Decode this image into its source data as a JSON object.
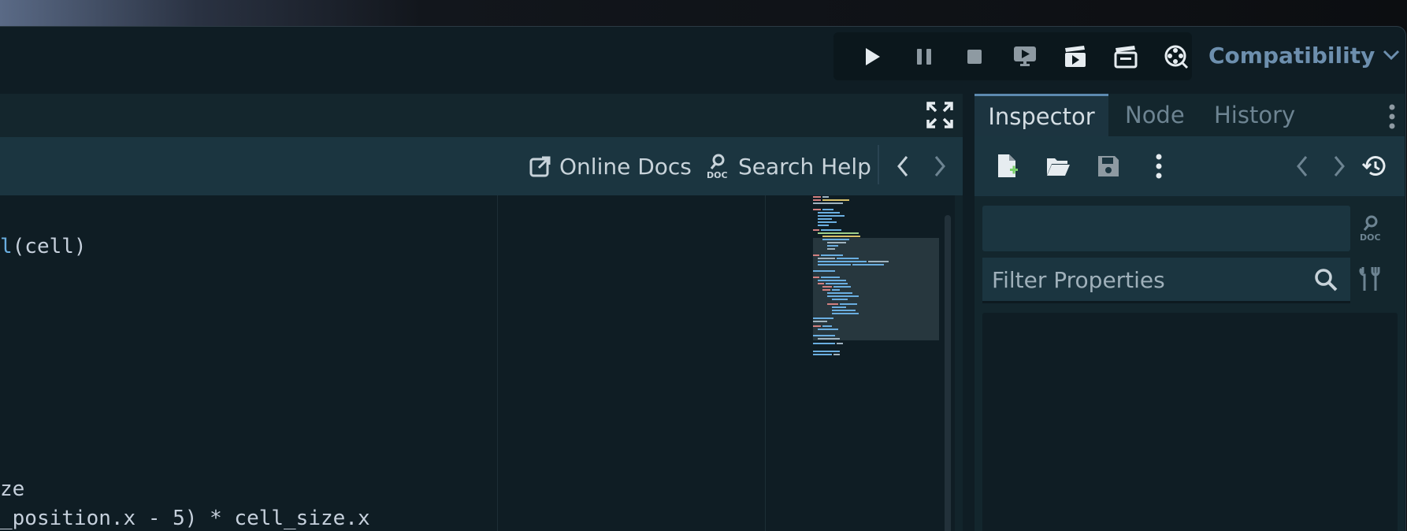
{
  "renderer": {
    "label": "Compatibility"
  },
  "toolbar": {
    "buttons": [
      "play-icon",
      "pause-icon",
      "stop-icon",
      "remote-deploy-icon",
      "run-current-scene-icon",
      "run-custom-scene-icon",
      "movie-maker-icon"
    ]
  },
  "script_editor": {
    "help": {
      "online_docs": "Online Docs",
      "search_help": "Search Help"
    },
    "code_lines": {
      "line1_fn": "l",
      "line1_rest": "(cell)",
      "line2": "ze",
      "line3": "_position.x - 5) * cell_size.x"
    }
  },
  "inspector": {
    "tabs": [
      {
        "label": "Inspector",
        "active": true
      },
      {
        "label": "Node",
        "active": false
      },
      {
        "label": "History",
        "active": false
      }
    ],
    "filter": {
      "placeholder": "Filter Properties",
      "value": ""
    }
  },
  "colors": {
    "accent": "#5d8ab0",
    "renderer_text": "#6d8fae",
    "panel_bg": "#13262d",
    "toolbar_bg": "#1b3540"
  }
}
